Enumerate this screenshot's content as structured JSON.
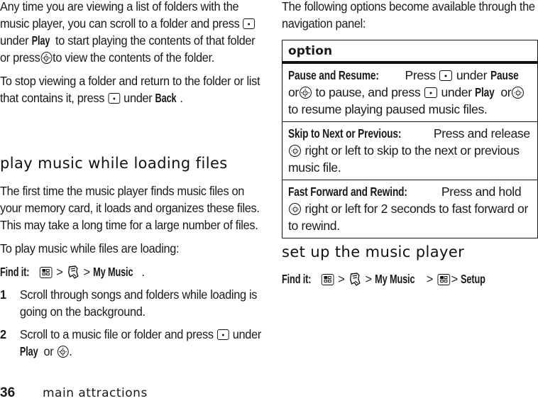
{
  "left": {
    "para1": {
      "t1": "Any time you are viewing a list of folders with the music player, you can scroll to a folder and press",
      "t2": "under",
      "play": "Play",
      "t3": "to start playing the contents of that folder or press",
      "t4": "to view the contents of the folder."
    },
    "para2": {
      "t1": "To stop viewing a folder and return to the folder or list that contains it, press",
      "t2": "under",
      "back": "Back",
      "t3": "."
    },
    "heading": "play music while loading files",
    "para3": "The first time the music player finds music files on your memory card, it loads and organizes these files. This may take a long time for a large number of files.",
    "para4": "To play music while files are loading:",
    "find_it": {
      "label": "Find it:",
      "sep": ">",
      "target": "My Music",
      "end": "."
    },
    "steps": [
      {
        "num": "1",
        "text": "Scroll through songs and folders while loading is going on the background."
      },
      {
        "num": "2",
        "text": "Scroll to a music file or folder and press",
        "under": "under",
        "play": "Play",
        "or": "or",
        "end": "."
      }
    ]
  },
  "right": {
    "intro": "The following options become available through the navigation panel:",
    "table": {
      "header": "option",
      "rows": [
        {
          "title": "Pause and Resume:",
          "t1": "Press",
          "t2": "under",
          "pause": "Pause",
          "t3": "or",
          "t4": "to pause, and press",
          "t5": "under",
          "play": "Play",
          "t6": "or",
          "t7": "to resume playing paused music files."
        },
        {
          "title": "Skip to Next or Previous:",
          "t1": "Press and release",
          "t2": "right or left to skip to the next or previous music file."
        },
        {
          "title": "Fast Forward and Rewind:",
          "t1": "Press and hold",
          "t2": "right or left for 2 seconds to fast forward or to rewind."
        }
      ]
    },
    "heading": "set up the music player",
    "find_it": {
      "label": "Find it:",
      "sep": ">",
      "my_music": "My Music",
      "setup": "Setup"
    }
  },
  "footer": {
    "page_number": "36",
    "section": "main attractions"
  },
  "icons": {
    "soft_key": "soft-key-icon",
    "nav_key": "nav-key-icon",
    "menu_key": "menu-key-icon",
    "multimedia": "multimedia-icon"
  }
}
